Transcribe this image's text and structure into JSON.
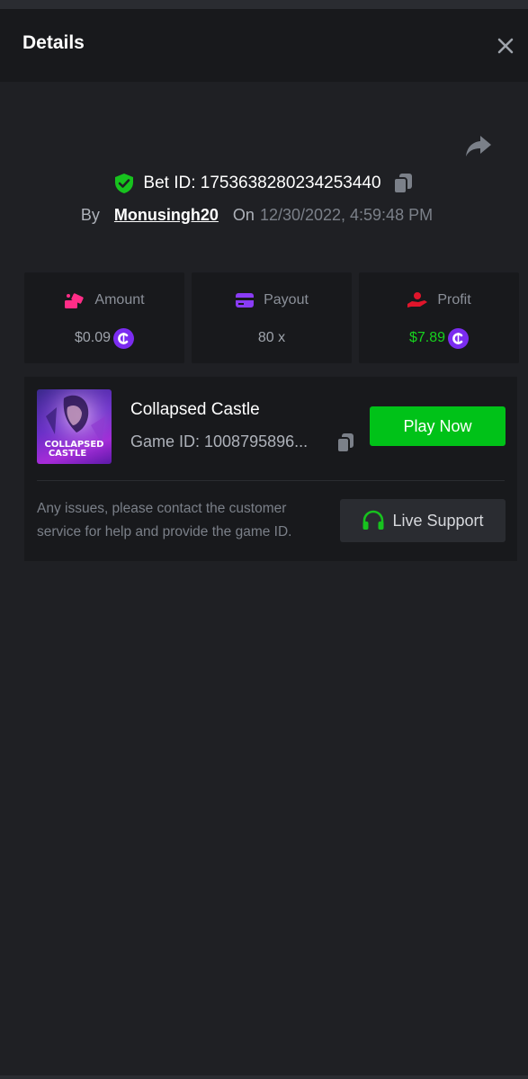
{
  "header": {
    "title": "Details"
  },
  "bet": {
    "id_label": "Bet ID: 1753638280234253440",
    "by_label": "By",
    "user": "Monusingh20",
    "on_label": "On",
    "date": "12/30/2022, 4:59:48 PM"
  },
  "stats": [
    {
      "label": "Amount",
      "value": "$0.09",
      "color": "#9ea3ab"
    },
    {
      "label": "Payout",
      "value": "80 x",
      "color": "#9ea3ab"
    },
    {
      "label": "Profit",
      "value": "$7.89",
      "color": "#17d21e"
    }
  ],
  "game": {
    "name": "Collapsed Castle",
    "id_label": "Game ID: 1008795896...",
    "thumb_text": "COLLAPSED CASTLE",
    "play_label": "Play Now",
    "help_text": "Any issues, please contact the customer service for help and provide the game ID.",
    "support_label": "Live Support"
  },
  "colors": {
    "background": "#1f2024",
    "card": "#18191c",
    "accent_green": "#00c218",
    "coin_purple": "#7b2cf0",
    "amount_icon": "#ff2d87",
    "payout_icon": "#8a3cf5",
    "profit_icon": "#e0152b"
  },
  "icons": {
    "close": "close-icon",
    "share": "share-icon",
    "shield": "shield-check-icon",
    "copy": "copy-icon",
    "amount": "amount-icon",
    "payout": "card-icon",
    "profit": "profit-hand-icon",
    "coin": "coin-icon",
    "support": "headset-icon"
  }
}
